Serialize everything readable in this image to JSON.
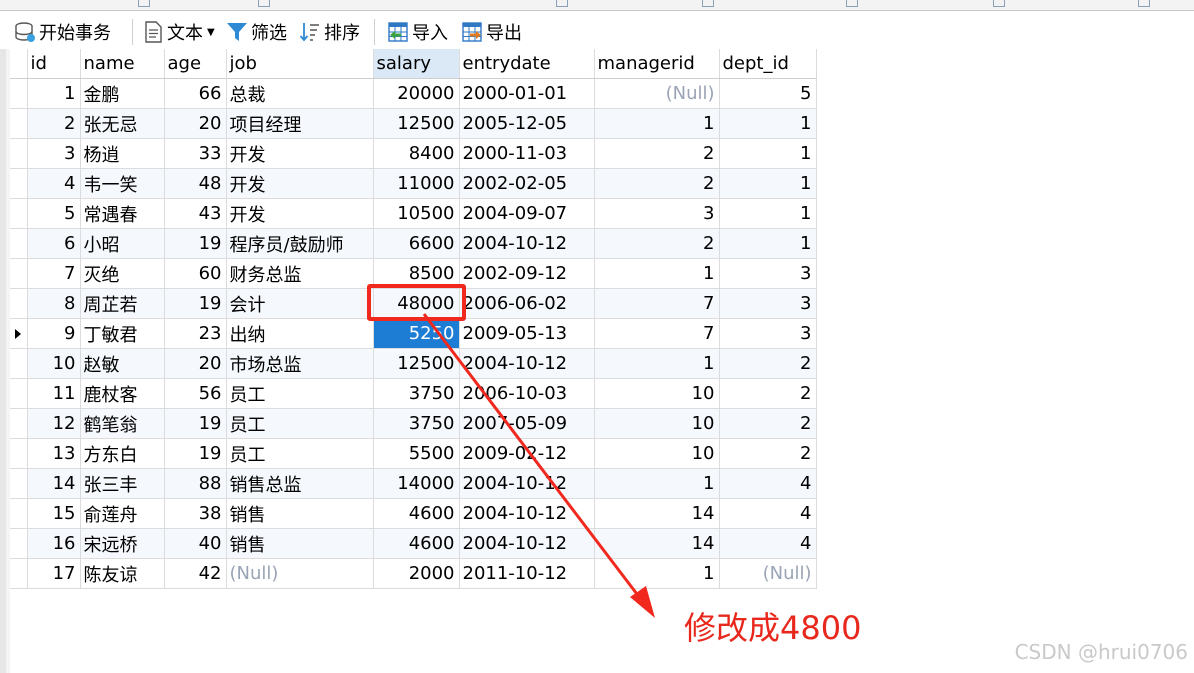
{
  "toolbar": {
    "begin_transaction": "开始事务",
    "text": "文本",
    "filter": "筛选",
    "sort": "排序",
    "import": "导入",
    "export": "导出"
  },
  "grid": {
    "columns": [
      "id",
      "name",
      "age",
      "job",
      "salary",
      "entrydate",
      "managerid",
      "dept_id"
    ],
    "selected_column": "salary",
    "rows": [
      [
        "1",
        "金鹏",
        "66",
        "总裁",
        "20000",
        "2000-01-01",
        "(Null)",
        "5"
      ],
      [
        "2",
        "张无忌",
        "20",
        "项目经理",
        "12500",
        "2005-12-05",
        "1",
        "1"
      ],
      [
        "3",
        "杨逍",
        "33",
        "开发",
        "8400",
        "2000-11-03",
        "2",
        "1"
      ],
      [
        "4",
        "韦一笑",
        "48",
        "开发",
        "11000",
        "2002-02-05",
        "2",
        "1"
      ],
      [
        "5",
        "常遇春",
        "43",
        "开发",
        "10500",
        "2004-09-07",
        "3",
        "1"
      ],
      [
        "6",
        "小昭",
        "19",
        "程序员/鼓励师",
        "6600",
        "2004-10-12",
        "2",
        "1"
      ],
      [
        "7",
        "灭绝",
        "60",
        "财务总监",
        "8500",
        "2002-09-12",
        "1",
        "3"
      ],
      [
        "8",
        "周芷若",
        "19",
        "会计",
        "48000",
        "2006-06-02",
        "7",
        "3"
      ],
      [
        "9",
        "丁敏君",
        "23",
        "出纳",
        "5250",
        "2009-05-13",
        "7",
        "3"
      ],
      [
        "10",
        "赵敏",
        "20",
        "市场总监",
        "12500",
        "2004-10-12",
        "1",
        "2"
      ],
      [
        "11",
        "鹿杖客",
        "56",
        "员工",
        "3750",
        "2006-10-03",
        "10",
        "2"
      ],
      [
        "12",
        "鹤笔翁",
        "19",
        "员工",
        "3750",
        "2007-05-09",
        "10",
        "2"
      ],
      [
        "13",
        "方东白",
        "19",
        "员工",
        "5500",
        "2009-02-12",
        "10",
        "2"
      ],
      [
        "14",
        "张三丰",
        "88",
        "销售总监",
        "14000",
        "2004-10-12",
        "1",
        "4"
      ],
      [
        "15",
        "俞莲舟",
        "38",
        "销售",
        "4600",
        "2004-10-12",
        "14",
        "4"
      ],
      [
        "16",
        "宋远桥",
        "40",
        "销售",
        "4600",
        "2004-10-12",
        "14",
        "4"
      ],
      [
        "17",
        "陈友谅",
        "42",
        "(Null)",
        "2000",
        "2011-10-12",
        "1",
        "(Null)"
      ]
    ],
    "current_row_index": 8,
    "selected_cell": {
      "row": 8,
      "col": 4
    },
    "highlighted_cell": {
      "row": 7,
      "col": 4
    }
  },
  "annotation": {
    "text": "修改成4800",
    "color": "#e8281d"
  },
  "watermark": "CSDN @hrui0706",
  "colors": {
    "selection": "#1d7dd4",
    "null_text": "#9aa4b6",
    "alt_row": "#f5f8fc",
    "annotation_red": "#f0281e"
  }
}
